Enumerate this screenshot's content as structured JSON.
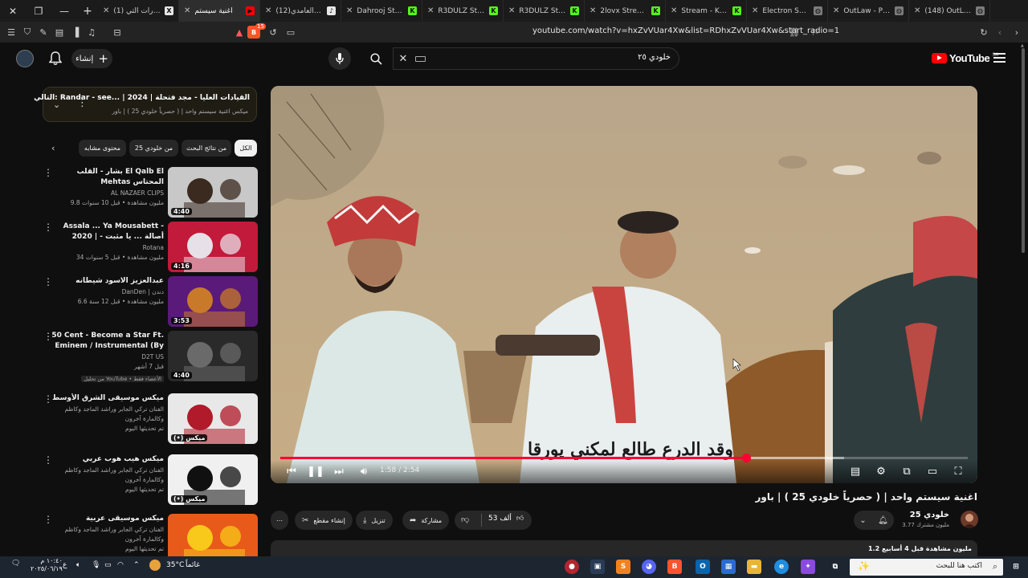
{
  "browser": {
    "tabs": [
      {
        "title": "(1) المنشورات التي",
        "fav": "X",
        "fav_color": "#e7e7e7",
        "active": false
      },
      {
        "title": "اغنية سيستم",
        "fav": "▶",
        "fav_color": "#ff0000",
        "active": true
      },
      {
        "title": "(12)حسن العامدي (",
        "fav": "♪",
        "fav_color": "#e7e7e7",
        "active": false
      },
      {
        "title": "Dahrooj Stream - W",
        "fav": "K",
        "fav_color": "#53fc18",
        "active": false
      },
      {
        "title": "R3DULZ Stream - W",
        "fav": "K",
        "fav_color": "#53fc18",
        "active": false
      },
      {
        "title": "R3DULZ Stream - W",
        "fav": "K",
        "fav_color": "#53fc18",
        "active": false
      },
      {
        "title": "2lovx Stream - Watc",
        "fav": "K",
        "fav_color": "#53fc18",
        "active": false
      },
      {
        "title": "Stream - Kick Dashb",
        "fav": "K",
        "fav_color": "#53fc18",
        "active": false
      },
      {
        "title": "Electron Services",
        "fav": "◍",
        "fav_color": "#7c7c7c",
        "active": false
      },
      {
        "title": "OutLaw - Player Pa",
        "fav": "◍",
        "fav_color": "#7c7c7c",
        "active": false
      },
      {
        "title": "(148) OutLawRp 2.0",
        "fav": "◍",
        "fav_color": "#7c7c7c",
        "active": false
      }
    ],
    "url": "youtube.com/watch?v=hxZvVUar4Xw&list=RDhxZvVUar4Xw&start_radio=1",
    "shield_count": "15"
  },
  "header": {
    "create_label": "إنشاء",
    "search_value": "خلودي ٢٥",
    "logo_text": "YouTube",
    "country": "SA"
  },
  "upnext": {
    "line1": "التالي: Randar - see... | القيادات العليا - مجد فتحلة | 2024",
    "line2": "ميكس اغنية سيستم واحد | ( حصرياً خلودي 25 ) | باور"
  },
  "chips": [
    "الكل",
    "من نتائج البحث",
    "من خلودي 25",
    "محتوى مشابه"
  ],
  "related": [
    {
      "title": "بشار - القلب El Qalb El Mehtas المحتاس",
      "channel": "AL NAZAER CLIPS",
      "meta": "9.8 مليون مشاهدة • قبل 10 سنوات",
      "duration": "4:40",
      "colors": [
        "#c8c8c8",
        "#3a2a20"
      ]
    },
    {
      "title": "Assala ... Ya Mousabett - 2020 | أصالة ... يا مثبت - بالكلمات",
      "channel": "Rotana",
      "meta": "34 مليون مشاهدة • قبل 5 سنوات",
      "duration": "4:16",
      "colors": [
        "#c21a3a",
        "#e8e0e8"
      ]
    },
    {
      "title": "عبدالعزيز الاسود شيطانه",
      "channel": "DanDen | دندن",
      "meta": "6.6 مليون مشاهدة • قبل 12 سنة",
      "duration": "3:53",
      "colors": [
        "#5a1a7a",
        "#c87a2a"
      ]
    },
    {
      "title": "50 Cent - Become a Star Ft. Eminem / Instrumental (By D2T)",
      "channel": "D2T US",
      "meta": "قبل 7 أشهر",
      "badge": "من تحليل YouTube • الأعضاء فقط",
      "duration": "4:40",
      "colors": [
        "#2a2a2a",
        "#6a6a6a"
      ]
    },
    {
      "title": "ميكس موسيقى الشرق الأوسط",
      "channel": "الفنان تركي الجابر وراشد الماجد وكاظم وكالمارة آخرون",
      "meta": "تم تحديثها اليوم",
      "duration": "(•) ميكس",
      "colors": [
        "#e8e8e8",
        "#b01a2a"
      ]
    },
    {
      "title": "ميكس هيب هوب عربي",
      "channel": "الفنان تركي الجابر وراشد الماجد وكاظم وكالمارة آخرون",
      "meta": "تم تحديثها اليوم",
      "duration": "(•) ميكس",
      "colors": [
        "#f0f0f0",
        "#101010"
      ]
    },
    {
      "title": "ميكس موسيقى عربية",
      "channel": "الفنان تركي الجابر وراشد الماجد وكاظم وكالمارة آخرون",
      "meta": "تم تحديثها اليوم",
      "duration": "",
      "colors": [
        "#e85a1a",
        "#f8c81a"
      ]
    }
  ],
  "player": {
    "current": "1:58",
    "total": "2:54",
    "time_text": "1:58 / 2:54",
    "played_fraction": 0.678,
    "loaded_fraction": 0.82,
    "subtitle": "وقد الدرع طالع لمكني يورقا"
  },
  "video": {
    "title": "اغنية سيستم واحد | ( حصرياً خلودي 25 ) | باور",
    "channel": "خلودي 25",
    "subscribers": "3.77 مليون مشترك",
    "likes": "53 ألف",
    "share_label": "مشاركة",
    "download_label": "تنزيل",
    "clip_label": "إنشاء مقطع",
    "description": "1.2 مليون مشاهدة قبل 4 أسابيع"
  },
  "taskbar": {
    "search_placeholder": "اكتب هنا للبحث",
    "weather": "35°C",
    "weather_desc": "غائماً",
    "lang": "ع",
    "time": "١٠:٤٠ م",
    "date": "٢٠٢٥/٠٦/١٩"
  },
  "colors": {
    "accent": "#ff0033",
    "bg": "#0f0f0f",
    "chip": "#272727"
  }
}
